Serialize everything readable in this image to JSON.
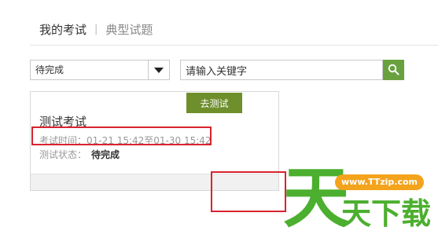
{
  "tabs": {
    "active": "我的考试",
    "separator": "|",
    "other": "典型试题"
  },
  "filter": {
    "selected": "待完成"
  },
  "search": {
    "value": "请输入关键字"
  },
  "exam_card": {
    "title": "测试考试",
    "time_label": "考试时间：",
    "time_value": "01-21 15:42至01-30 15:42",
    "status_label": "测试状态：",
    "status_value": "待完成",
    "button_label": "去测试"
  },
  "colors": {
    "accent_green": "#6aa13f",
    "button_olive": "#6f8f2c",
    "highlight_red": "#d9232e",
    "watermark_orange": "#f3a31c"
  },
  "watermark": {
    "big_char": "天",
    "url": "www.TTzip.com",
    "text": "天下载"
  }
}
